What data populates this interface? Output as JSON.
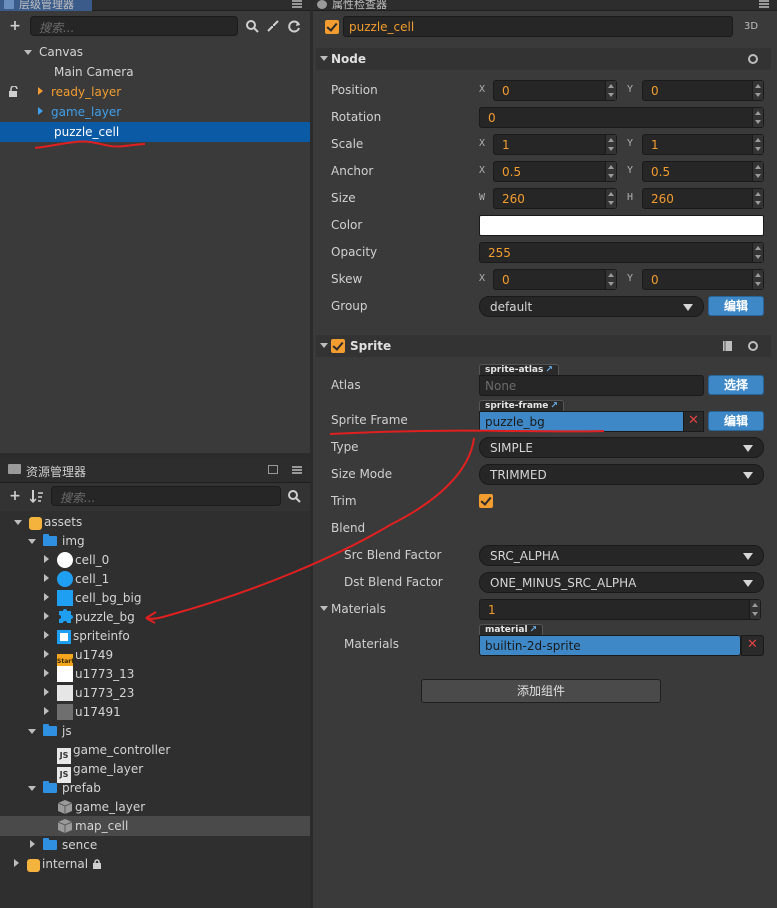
{
  "hierarchy": {
    "title": "层级管理器",
    "search_placeholder": "搜索...",
    "add_button": "+",
    "items": [
      {
        "label": "Canvas"
      },
      {
        "label": "Main Camera"
      },
      {
        "label": "ready_layer"
      },
      {
        "label": "game_layer"
      },
      {
        "label": "puzzle_cell"
      }
    ]
  },
  "assets": {
    "title": "资源管理器",
    "search_placeholder": "搜索...",
    "add_button": "+",
    "items": [
      {
        "label": "assets"
      },
      {
        "label": "img"
      },
      {
        "label": "cell_0"
      },
      {
        "label": "cell_1"
      },
      {
        "label": "cell_bg_big"
      },
      {
        "label": "puzzle_bg"
      },
      {
        "label": "spriteinfo"
      },
      {
        "label": "u1749"
      },
      {
        "label": "u1773_13"
      },
      {
        "label": "u1773_23"
      },
      {
        "label": "u17491"
      },
      {
        "label": "js"
      },
      {
        "label": "game_controller"
      },
      {
        "label": "game_layer"
      },
      {
        "label": "prefab"
      },
      {
        "label": "game_layer"
      },
      {
        "label": "map_cell"
      },
      {
        "label": "sence"
      },
      {
        "label": "internal"
      }
    ],
    "js_badge": "JS",
    "start_badge": "Start"
  },
  "inspector": {
    "title": "属性检查器",
    "node_name": "puzzle_cell",
    "mode_3d": "3D",
    "node_section": "Node",
    "position_label": "Position",
    "position_x": "0",
    "position_y": "0",
    "rotation_label": "Rotation",
    "rotation": "0",
    "scale_label": "Scale",
    "scale_x": "1",
    "scale_y": "1",
    "anchor_label": "Anchor",
    "anchor_x": "0.5",
    "anchor_y": "0.5",
    "size_label": "Size",
    "size_w": "260",
    "size_h": "260",
    "color_label": "Color",
    "opacity_label": "Opacity",
    "opacity": "255",
    "skew_label": "Skew",
    "skew_x": "0",
    "skew_y": "0",
    "group_label": "Group",
    "group": "default",
    "edit_button": "编辑",
    "axis_x": "X",
    "axis_y": "Y",
    "axis_w": "W",
    "axis_h": "H",
    "sprite_section": "Sprite",
    "atlas_label": "Atlas",
    "atlas_tag": "sprite-atlas",
    "atlas_value": "None",
    "select_button": "选择",
    "sprite_frame_label": "Sprite Frame",
    "sprite_frame_tag": "sprite-frame",
    "sprite_frame_value": "puzzle_bg",
    "type_label": "Type",
    "type": "SIMPLE",
    "size_mode_label": "Size Mode",
    "size_mode": "TRIMMED",
    "trim_label": "Trim",
    "blend_label": "Blend",
    "src_blend_label": "Src Blend Factor",
    "src_blend": "SRC_ALPHA",
    "dst_blend_label": "Dst Blend Factor",
    "dst_blend": "ONE_MINUS_SRC_ALPHA",
    "materials_label": "Materials",
    "materials_count": "1",
    "materials_item_label": "Materials",
    "material_tag": "material",
    "material_value": "builtin-2d-sprite",
    "add_component_button": "添加组件"
  },
  "colors": {
    "accent_orange": "#f39c2f",
    "selection_blue": "#0b5aa6",
    "button_blue": "#3e88c7",
    "annotation_red": "#e02020"
  }
}
